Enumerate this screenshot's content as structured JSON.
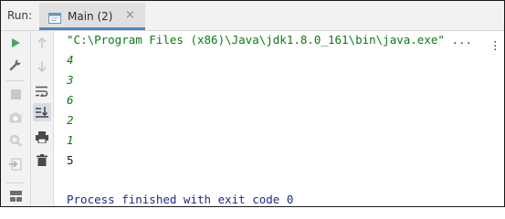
{
  "run_header": {
    "run_label": "Run:",
    "tab_label": "Main (2)",
    "tab_close": "×"
  },
  "toolbar_left": [
    {
      "name": "rerun-icon",
      "color": "#4aa55a"
    },
    {
      "name": "wrench-icon",
      "color": "#6e6e6e"
    },
    {
      "name": "stop-icon",
      "color": "#c8c8c8"
    },
    {
      "name": "camera-icon",
      "color": "#c8c8c8"
    },
    {
      "name": "debug-settings-icon",
      "color": "#c8c8c8"
    },
    {
      "name": "exit-icon",
      "color": "#c8c8c8"
    },
    {
      "name": "layout-icon",
      "color": "#6e6e6e"
    }
  ],
  "toolbar_mid": [
    {
      "name": "up-arrow-icon"
    },
    {
      "name": "down-arrow-icon"
    },
    {
      "name": "soft-wrap-icon"
    },
    {
      "name": "scroll-to-end-icon",
      "selected": true
    },
    {
      "name": "print-icon"
    },
    {
      "name": "trash-icon"
    }
  ],
  "console": {
    "command": "\"C:\\Program Files (x86)\\Java\\jdk1.8.0_161\\bin\\java.exe\" ...",
    "fold_marker": "⋮",
    "output_lines": [
      {
        "text": "4",
        "stream": "stderr"
      },
      {
        "text": "3",
        "stream": "stderr"
      },
      {
        "text": "6",
        "stream": "stderr"
      },
      {
        "text": "2",
        "stream": "stderr"
      },
      {
        "text": "1",
        "stream": "stderr"
      },
      {
        "text": "5",
        "stream": "stdout"
      }
    ],
    "exit_message": "Process finished with exit code 0"
  },
  "colors": {
    "command_text": "#0a7a13",
    "stderr_text": "#0a7a13",
    "stdout_text": "#1a1a1a",
    "exit_text": "#1f2a8c",
    "tab_accent": "#4a88c7"
  }
}
